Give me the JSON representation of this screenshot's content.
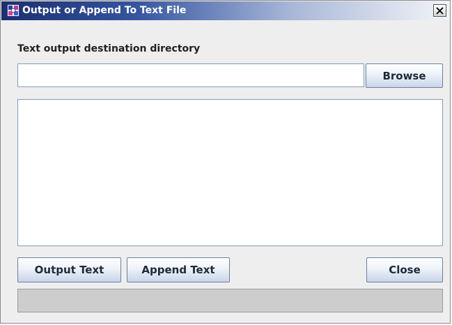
{
  "window": {
    "title": "Output or Append To Text File"
  },
  "form": {
    "destination_label": "Text output destination directory",
    "destination_value": "",
    "output_text": ""
  },
  "buttons": {
    "browse": "Browse",
    "output_text": "Output Text",
    "append_text": "Append Text",
    "close": "Close"
  },
  "progress": {
    "fraction": 0
  },
  "icons": {
    "app": "app-icon",
    "close": "close-icon"
  }
}
